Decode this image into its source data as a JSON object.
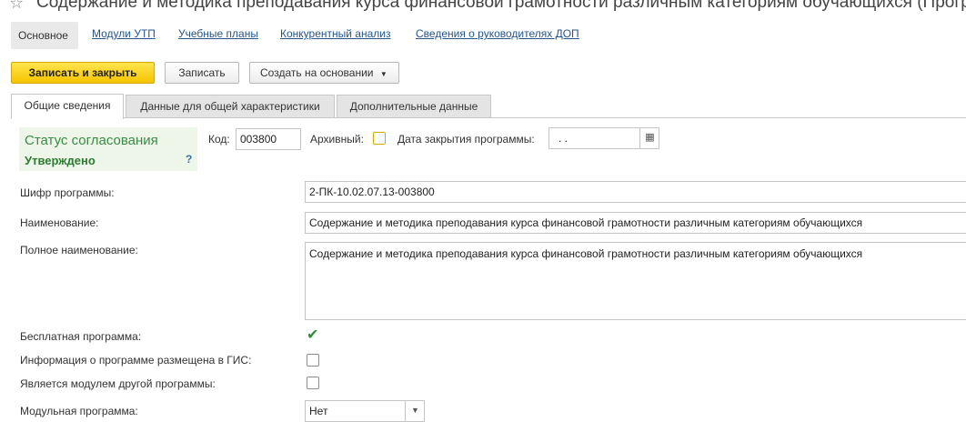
{
  "window": {
    "title": "Содержание и методика преподавания курса финансовой грамотности различным категориям обучающихся (Програ"
  },
  "nav": {
    "items": [
      "Основное",
      "Модули УТП",
      "Учебные планы",
      "Конкурентный анализ",
      "Сведения о руководителях ДОП"
    ]
  },
  "toolbar": {
    "save_close_label": "Записать и закрыть",
    "save_label": "Записать",
    "create_based_label": "Создать на основании"
  },
  "tabs": {
    "items": [
      "Общие сведения",
      "Данные для общей характеристики",
      "Дополнительные данные"
    ]
  },
  "status": {
    "label": "Статус согласования",
    "value": "Утверждено",
    "help": "?"
  },
  "form": {
    "code_label": "Код:",
    "code_value": "003800",
    "archived_label": "Архивный:",
    "close_date_label": "Дата закрытия программы:",
    "close_date_value": " .  .",
    "cipher_label": "Шифр программы:",
    "cipher_value": "2-ПК-10.02.07.13-003800",
    "name_label": "Наименование:",
    "name_value": "Содержание и методика преподавания курса финансовой грамотности различным категориям обучающихся",
    "full_name_label": "Полное наименование:",
    "full_name_value": "Содержание и методика преподавания курса финансовой грамотности различным категориям обучающихся",
    "free_label": "Бесплатная программа:",
    "free_checked": true,
    "gis_label": "Информация о программе размещена в ГИС:",
    "gis_checked": false,
    "module_of_label": "Является модулем другой программы:",
    "module_of_checked": false,
    "modular_label": "Модульная программа:",
    "modular_value": "Нет"
  },
  "icons": {
    "star": "star-icon",
    "calendar": "calendar-icon",
    "dropdown": "chevron-down-icon",
    "check": "check-icon"
  }
}
